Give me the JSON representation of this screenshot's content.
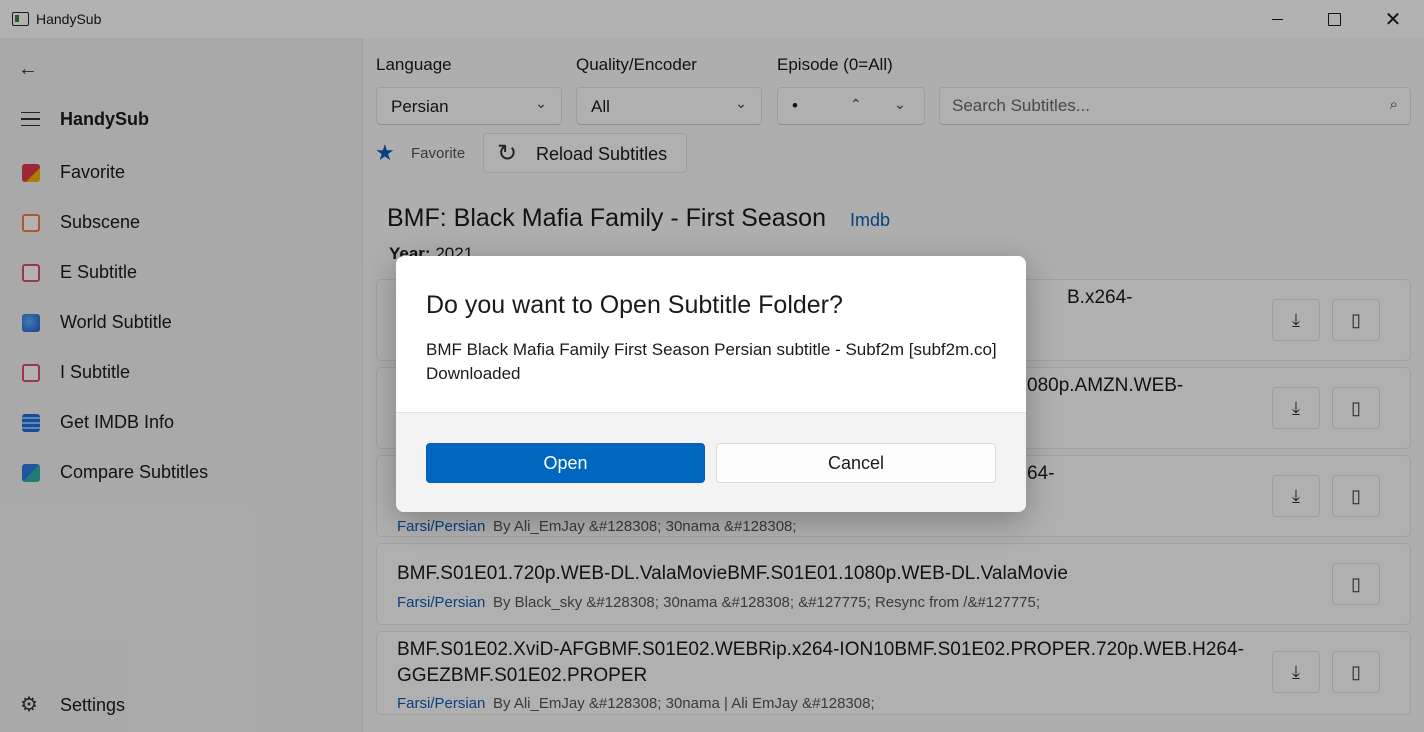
{
  "window": {
    "title": "HandySub",
    "close_glyph": "✕"
  },
  "sidebar": {
    "title": "HandySub",
    "back_glyph": "←",
    "items": [
      {
        "label": "Favorite",
        "icon": "favorite-icon"
      },
      {
        "label": "Subscene",
        "icon": "home-icon"
      },
      {
        "label": "E Subtitle",
        "icon": "e-subtitle-icon"
      },
      {
        "label": "World Subtitle",
        "icon": "globe-icon"
      },
      {
        "label": "I Subtitle",
        "icon": "i-subtitle-icon"
      },
      {
        "label": "Get IMDB Info",
        "icon": "film-icon"
      },
      {
        "label": "Compare Subtitles",
        "icon": "compare-icon"
      }
    ],
    "settings_label": "Settings",
    "settings_glyph": "⚙"
  },
  "filters": {
    "language_label": "Language",
    "language_value": "Persian",
    "quality_label": "Quality/Encoder",
    "quality_value": "All",
    "episode_label": "Episode (0=All)",
    "episode_value": "•",
    "chevron_down": "⌄",
    "chevron_up": "⌃",
    "search_placeholder": "Search Subtitles...",
    "search_glyph": "⌕"
  },
  "toolbar": {
    "favorite_label": "Favorite",
    "star_glyph": "★",
    "reload_label": "Reload Subtitles",
    "reload_glyph": "↻"
  },
  "show": {
    "title": "BMF: Black Mafia Family - First Season",
    "imdb_label": "Imdb",
    "year_label": "Year:",
    "year_value": "2021"
  },
  "buttons": {
    "download_glyph": "⤓",
    "open_glyph": "▯"
  },
  "subtitles": [
    {
      "title": "B.x264-",
      "language": "",
      "author": ""
    },
    {
      "title": "080p.AMZN.WEB-",
      "language": "",
      "author": ""
    },
    {
      "title": "64-",
      "language": "Farsi/Persian",
      "author": "By Ali_EmJay &#128308; 30nama &#128308;"
    },
    {
      "title": "BMF.S01E01.720p.WEB-DL.ValaMovieBMF.S01E01.1080p.WEB-DL.ValaMovie",
      "language": "Farsi/Persian",
      "author": "By Black_sky &#128308; 30nama &#128308; &#127775; Resync from /&#127775;"
    },
    {
      "title": "BMF.S01E02.XviD-AFGBMF.S01E02.WEBRip.x264-ION10BMF.S01E02.PROPER.720p.WEB.H264-GGEZBMF.S01E02.PROPER",
      "language": "Farsi/Persian",
      "author": "By Ali_EmJay &#128308; 30nama | Ali EmJay &#128308;"
    }
  ],
  "dialog": {
    "title": "Do you want to Open Subtitle Folder?",
    "message": "BMF Black Mafia Family First Season Persian subtitle - Subf2m [subf2m.co] Downloaded",
    "primary_label": "Open",
    "secondary_label": "Cancel"
  }
}
